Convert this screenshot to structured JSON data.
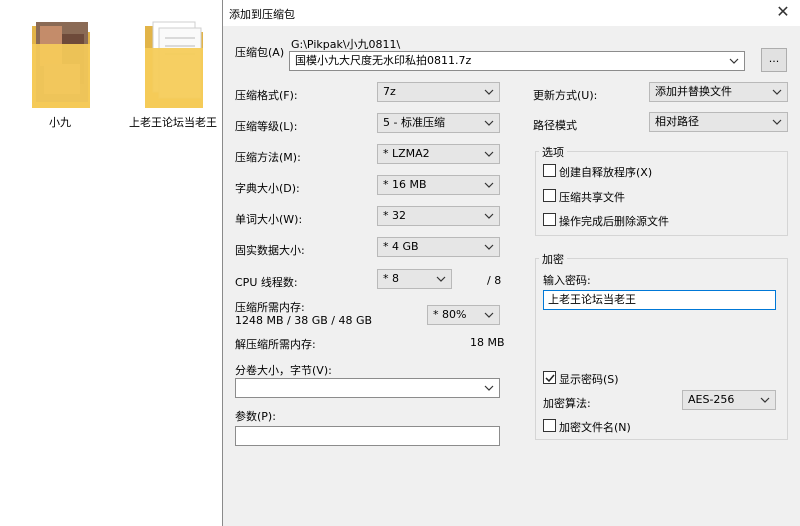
{
  "desktop": {
    "icons": [
      {
        "label": "小九"
      },
      {
        "label": "上老王论坛当老王"
      }
    ]
  },
  "dialog": {
    "title": "添加到压缩包",
    "close_glyph": "✕",
    "archive": {
      "label": "压缩包(A)",
      "path": "G:\\Pikpak\\小九0811\\",
      "filename": "国模小九大尺度无水印私拍0811.7z",
      "browse_label": "..."
    },
    "left": {
      "format": {
        "label": "压缩格式(F):",
        "value": "7z"
      },
      "level": {
        "label": "压缩等级(L):",
        "value": "5 - 标准压缩"
      },
      "method": {
        "label": "压缩方法(M):",
        "value": "* LZMA2"
      },
      "dict": {
        "label": "字典大小(D):",
        "value": "* 16 MB"
      },
      "word": {
        "label": "单词大小(W):",
        "value": "* 32"
      },
      "solid": {
        "label": "固实数据大小:",
        "value": "* 4 GB"
      },
      "cpu": {
        "label": "CPU 线程数:",
        "value": "* 8",
        "max": "/ 8"
      },
      "mem_comp": {
        "label": "压缩所需内存:",
        "detail": "1248 MB / 38 GB / 48 GB",
        "value": "* 80%"
      },
      "mem_decomp": {
        "label": "解压缩所需内存:",
        "value": "18 MB"
      },
      "split": {
        "label": "分卷大小，字节(V):",
        "value": ""
      },
      "params": {
        "label": "参数(P):",
        "value": ""
      }
    },
    "right": {
      "update": {
        "label": "更新方式(U):",
        "value": "添加并替换文件"
      },
      "path_mode": {
        "label": "路径模式",
        "value": "相对路径"
      },
      "options": {
        "title": "选项",
        "sfx": "创建自释放程序(X)",
        "shared": "压缩共享文件",
        "delete": "操作完成后删除源文件"
      },
      "encryption": {
        "title": "加密",
        "password_label": "输入密码:",
        "password_value": "上老王论坛当老王",
        "show_password": "显示密码(S)",
        "method_label": "加密算法:",
        "method_value": "AES-256",
        "encrypt_names": "加密文件名(N)"
      }
    }
  }
}
